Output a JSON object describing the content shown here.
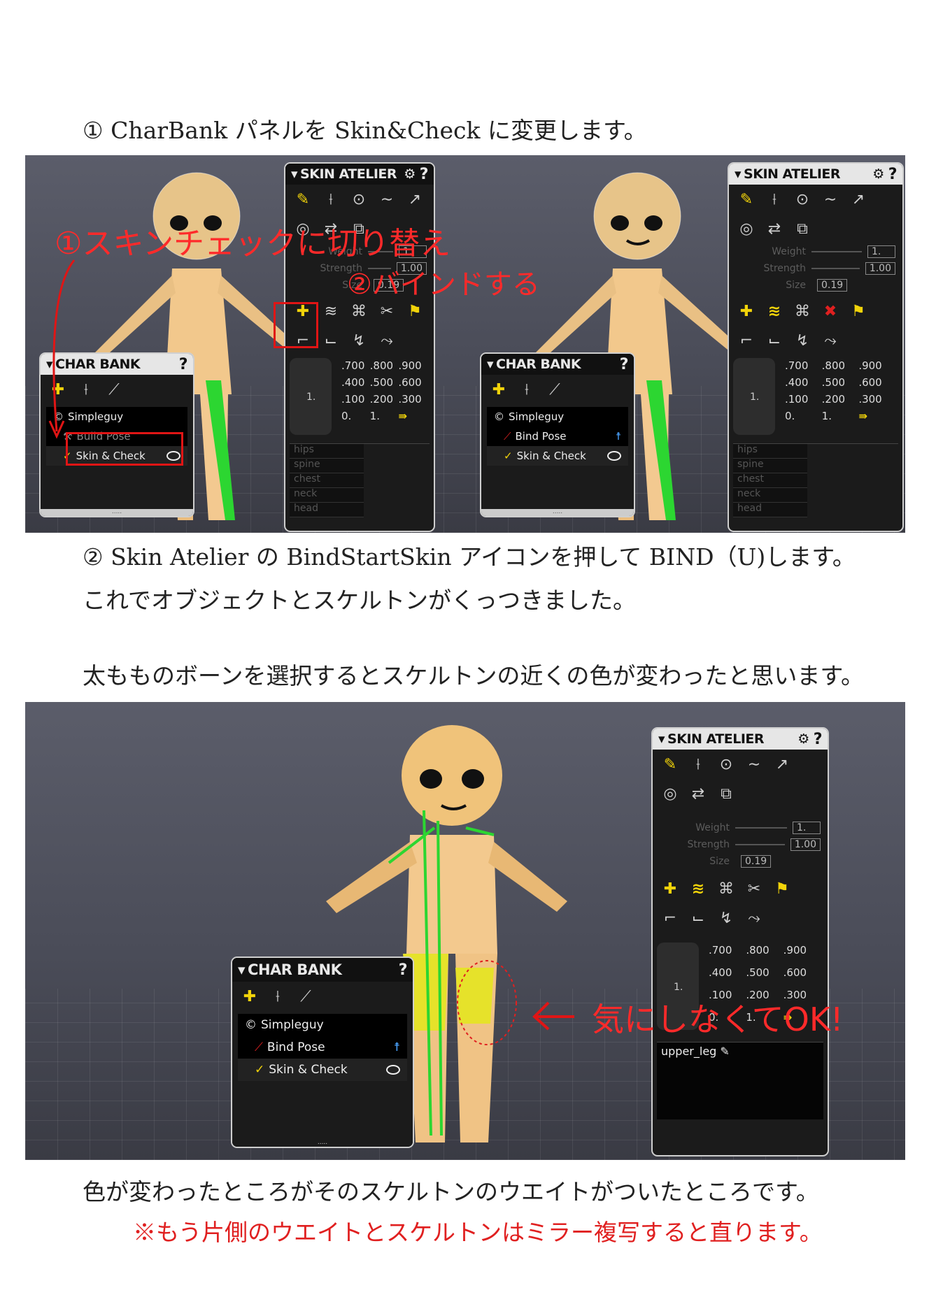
{
  "text": {
    "step1": "① CharBank パネルを Skin&Check に変更します。",
    "step2": "② Skin Atelier の BindStartSkin アイコンを押して BIND（U)します。",
    "step2b": "これでオブジェクトとスケルトンがくっつきました。",
    "para3": "太もものボーンを選択するとスケルトンの近くの色が変わったと思います。",
    "para4": "色が変わったところがそのスケルトンのウエイトがついたところです。",
    "note": "※もう片側のウエイトとスケルトンはミラー複写すると直ります。"
  },
  "annotations": {
    "switch_skin_check": "①スキンチェックに切り替え",
    "bind": "②バインドする",
    "dont_worry": "気にしなくてOK!"
  },
  "skin_atelier": {
    "title": "SKIN ATELIER",
    "weight_label": "Weight",
    "weight_value": "1.",
    "strength_label": "Strength",
    "strength_value": "1.00",
    "size_label": "Size",
    "size_value": "0.19",
    "grid_values": [
      ".700",
      ".800",
      ".900",
      ".400",
      ".500",
      ".600",
      ".100",
      ".200",
      ".300",
      "0.",
      "1."
    ],
    "pad_value": "1.",
    "bones": [
      "hips",
      "spine",
      "chest",
      "neck",
      "head"
    ],
    "selected_bone": "upper_leg"
  },
  "char_bank": {
    "title": "CHAR BANK",
    "character": "Simpleguy",
    "build_pose": "Build Pose",
    "bind_pose": "Bind Pose",
    "skin_check": "Skin & Check",
    "grip": "....."
  },
  "colors": {
    "annotation_red": "#ff2a2a",
    "accent_yellow": "#f1d30a",
    "panel_bg": "#1b1b1b"
  }
}
